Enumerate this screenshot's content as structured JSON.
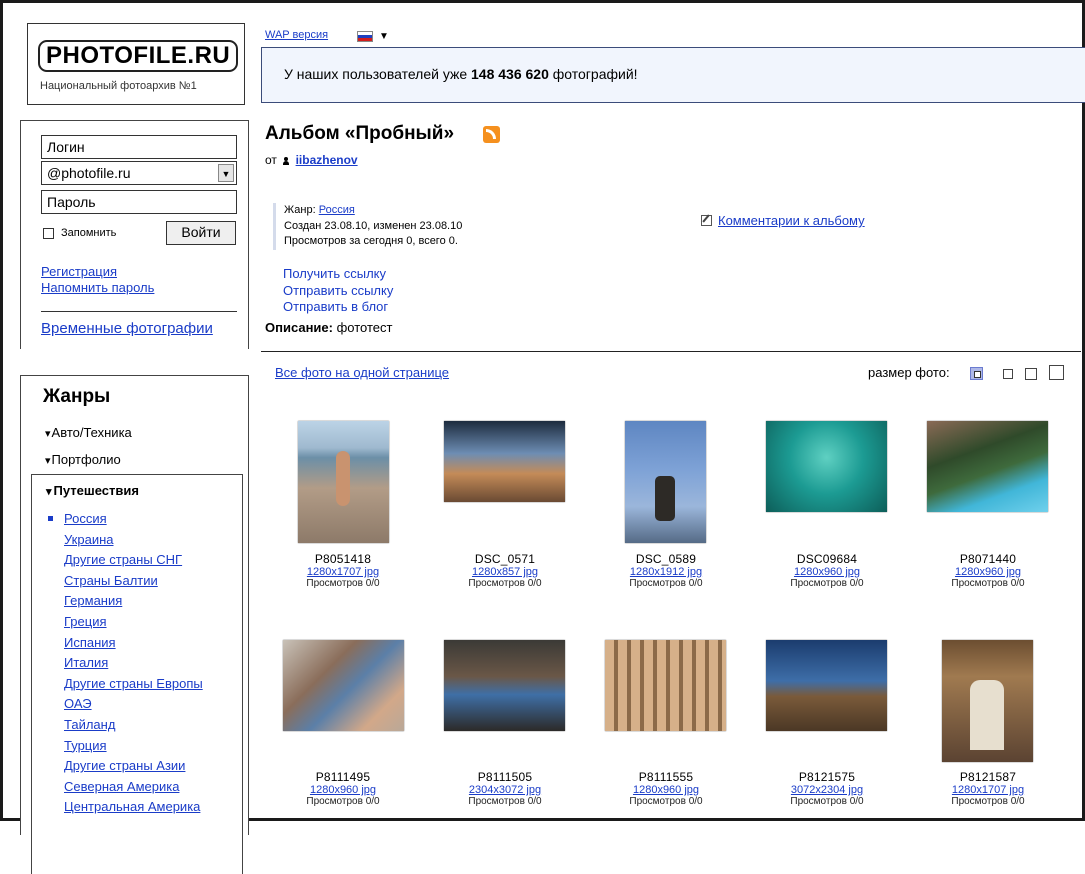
{
  "logo": {
    "title": "PHOTOFILE.RU",
    "subtitle": "Национальный фотоархив №1"
  },
  "top": {
    "wap_link": "WAP версия"
  },
  "banner": {
    "prefix": "У наших пользователей уже",
    "count": "148 436 620",
    "suffix": "фотографий!"
  },
  "login": {
    "login_placeholder": "Логин",
    "domain_value": "@photofile.ru",
    "password_placeholder": "Пароль",
    "remember_label": "Запомнить",
    "submit_label": "Войти",
    "register_link": "Регистрация",
    "remind_link": "Напомнить пароль",
    "temp_photos_link": "Временные фотографии"
  },
  "genres": {
    "title": "Жанры",
    "items": [
      "Авто/Техника",
      "Портфолио"
    ],
    "expanded": {
      "label": "Путешествия",
      "subitems": [
        "Россия",
        "Украина",
        "Другие страны СНГ",
        "Страны Балтии",
        "Германия",
        "Греция",
        "Испания",
        "Италия",
        "Другие страны Европы",
        "ОАЭ",
        "Тайланд",
        "Турция",
        "Другие страны Азии",
        "Северная Америка",
        "Центральная Америка"
      ]
    }
  },
  "album": {
    "title": "Альбом «Пробный»",
    "author_prefix": "от",
    "author": "iibazhenov",
    "genre_label": "Жанр:",
    "genre_value": "Россия",
    "created": "Создан 23.08.10, изменен 23.08.10",
    "views": "Просмотров за сегодня 0, всего 0.",
    "comments_link": "Комментарии к альбому",
    "actions": [
      "Получить ссылку",
      "Отправить ссылку",
      "Отправить в блог"
    ],
    "desc_label": "Описание:",
    "desc_value": "фототест"
  },
  "toolbar": {
    "all_photos_link": "Все фото на одной странице",
    "size_label": "размер фото:"
  },
  "photos": [
    {
      "name": "P8051418",
      "dims": "1280x1707 jpg",
      "views": "Просмотров 0/0"
    },
    {
      "name": "DSC_0571",
      "dims": "1280x857 jpg",
      "views": "Просмотров 0/0"
    },
    {
      "name": "DSC_0589",
      "dims": "1280x1912 jpg",
      "views": "Просмотров 0/0"
    },
    {
      "name": "DSC09684",
      "dims": "1280x960 jpg",
      "views": "Просмотров 0/0"
    },
    {
      "name": "P8071440",
      "dims": "1280x960 jpg",
      "views": "Просмотров 0/0"
    },
    {
      "name": "P8111495",
      "dims": "1280x960 jpg",
      "views": "Просмотров 0/0"
    },
    {
      "name": "P8111505",
      "dims": "2304x3072 jpg",
      "views": "Просмотров 0/0"
    },
    {
      "name": "P8111555",
      "dims": "1280x960 jpg",
      "views": "Просмотров 0/0"
    },
    {
      "name": "P8121575",
      "dims": "3072x2304 jpg",
      "views": "Просмотров 0/0"
    },
    {
      "name": "P8121587",
      "dims": "1280x1707 jpg",
      "views": "Просмотров 0/0"
    }
  ],
  "colors": {
    "link": "#1a3cc8",
    "banner_bg": "#f1f5fd",
    "rss": "#f5901e",
    "size_selected": "#7f8ed8"
  }
}
